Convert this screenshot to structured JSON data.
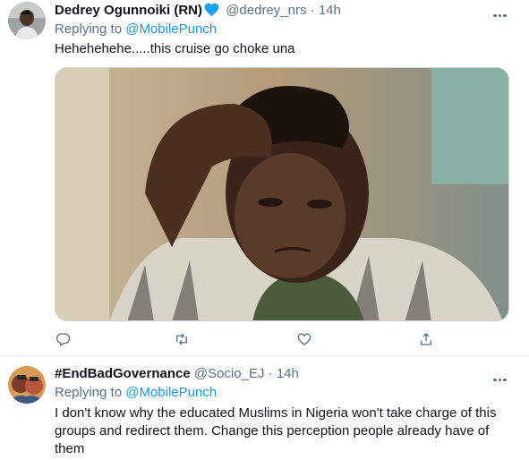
{
  "tweets": [
    {
      "name": "Dedrey Ogunnoiki (RN)",
      "handle": "@dedrey_nrs",
      "separator": "·",
      "time": "14h",
      "replying_prefix": "Replying to",
      "replying_to": "@MobilePunch",
      "text": "Hehehehehe.....this cruise go choke una",
      "verified": true
    },
    {
      "name": "#EndBadGovernance",
      "handle": "@Socio_EJ",
      "separator": "·",
      "time": "14h",
      "replying_prefix": "Replying to",
      "replying_to": "@MobilePunch",
      "text": "I don't know why the educated Muslims in Nigeria won't take charge of this groups and redirect them. Change this perception people already have of them",
      "verified": false
    }
  ],
  "icons": {
    "reply": "reply-icon",
    "retweet": "retweet-icon",
    "like": "heart-icon",
    "share": "share-icon",
    "more": "more-icon",
    "verified": "verified-badge-icon"
  },
  "colors": {
    "text": "#0f1419",
    "secondary": "#5b7083",
    "link": "#1b95e0",
    "verified": "#1da1f2",
    "divider": "#e6ecf0"
  }
}
